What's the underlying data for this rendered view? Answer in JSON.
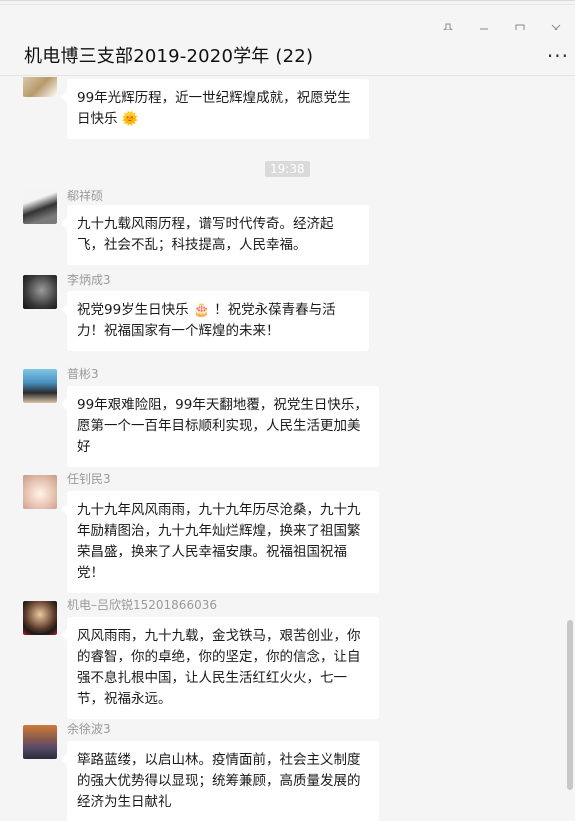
{
  "window": {
    "title": "机电博三支部2019-2020学年 (22)",
    "more_icon": "more-icon",
    "controls": [
      "pin-icon",
      "minimize-icon",
      "maximize-icon",
      "close-icon"
    ]
  },
  "timestamp": "19:38",
  "messages": [
    {
      "sender": "",
      "text": "99年光辉历程，近一世纪辉煌成就，祝愿党生日快乐 🌞"
    },
    {
      "sender": "郗祥硕",
      "text": "九十九载风雨历程，谱写时代传奇。经济起飞，社会不乱；科技提高，人民幸福。"
    },
    {
      "sender": "李炳成3",
      "text": "祝党99岁生日快乐 🎂 ！祝党永葆青春与活力！祝福国家有一个辉煌的未来！"
    },
    {
      "sender": "普彬3",
      "text": "99年艰难险阻，99年天翻地覆，祝党生日快乐，愿第一个一百年目标顺利实现，人民生活更加美好"
    },
    {
      "sender": "任钊民3",
      "text": "九十九年风风雨雨，九十九年历尽沧桑，九十九年励精图治，九十九年灿烂辉煌，换来了祖国繁荣昌盛，换来了人民幸福安康。祝福祖国祝福党！"
    },
    {
      "sender": "机电–吕欣锐15201866036",
      "text": "风风雨雨，九十九载，金戈铁马，艰苦创业，你的睿智，你的卓绝，你的坚定，你的信念，让自强不息扎根中国，让人民生活红红火火，七一节，祝福永远。"
    },
    {
      "sender": "余徐波3",
      "text": "筚路蓝缕，以启山林。疫情面前，社会主义制度的强大优势得以显现；统筹兼顾，高质量发展的经济为生日献礼"
    }
  ]
}
